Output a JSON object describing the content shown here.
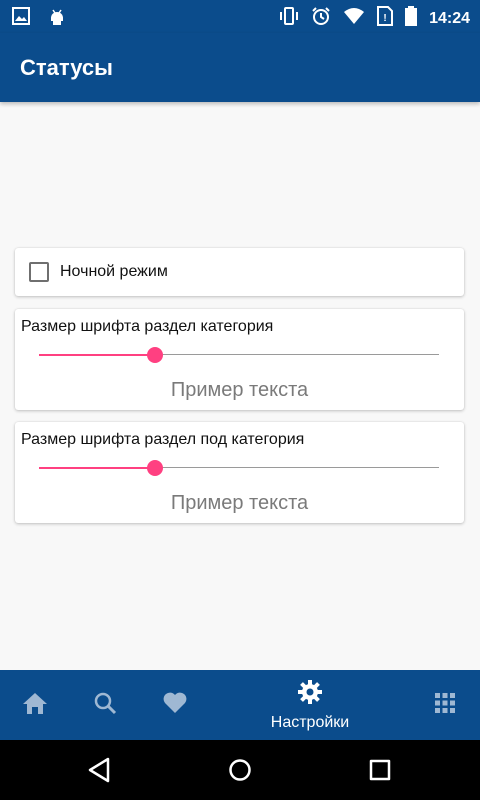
{
  "status_bar": {
    "time": "14:24",
    "left_icons": [
      "image-icon",
      "android-debug-icon"
    ],
    "right_icons": [
      "vibrate-icon",
      "alarm-icon",
      "wifi-icon",
      "no-sim-icon",
      "battery-icon"
    ]
  },
  "app_bar": {
    "title": "Статусы"
  },
  "settings": {
    "night_mode": {
      "label": "Ночной режим",
      "checked": false
    },
    "font_category": {
      "label": "Размер шрифта раздел категория",
      "value": 0.29,
      "sample": "Пример текста"
    },
    "font_subcategory": {
      "label": "Размер шрифта раздел под категория",
      "value": 0.29,
      "sample": "Пример текста"
    }
  },
  "bottom_nav": {
    "items": [
      {
        "icon": "home-icon",
        "label": ""
      },
      {
        "icon": "search-icon",
        "label": ""
      },
      {
        "icon": "heart-icon",
        "label": ""
      },
      {
        "icon": "gear-icon",
        "label": "Настройки",
        "active": true
      },
      {
        "icon": "apps-grid-icon",
        "label": ""
      }
    ]
  },
  "colors": {
    "primary": "#0b4c8c",
    "accent": "#ff4081",
    "background": "#f8f8f8"
  }
}
